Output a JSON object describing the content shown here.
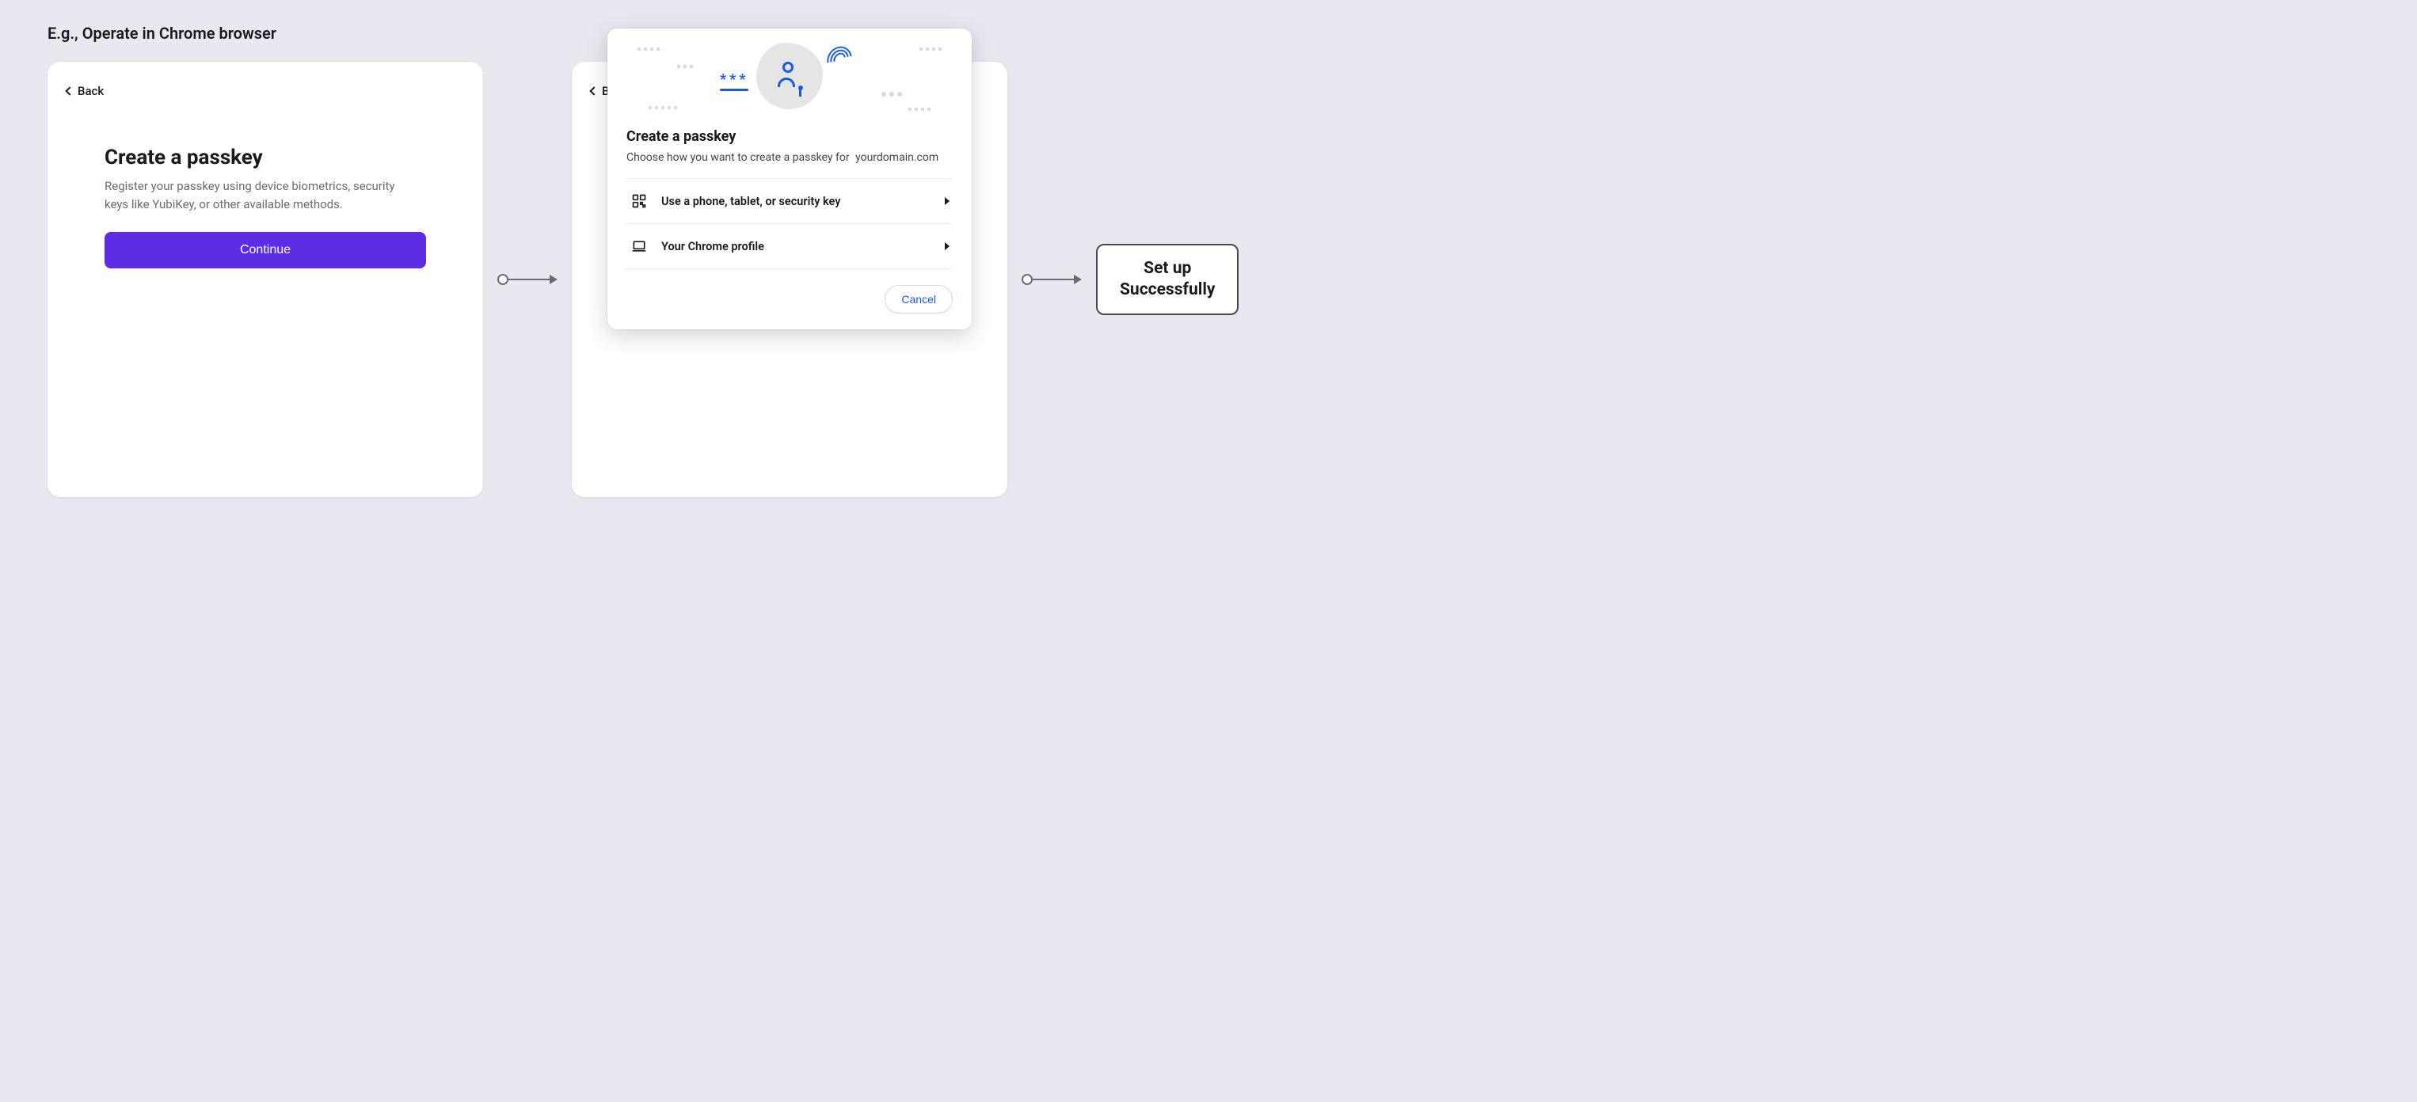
{
  "caption": "E.g., Operate in Chrome browser",
  "step1": {
    "back_label": "Back",
    "title": "Create a passkey",
    "description": "Register your passkey using device biometrics, security keys like YubiKey, or other available methods.",
    "continue_label": "Continue"
  },
  "step2": {
    "back_label_partial": "B",
    "dialog": {
      "title": "Create a passkey",
      "subtitle_prefix": "Choose how you want to create a passkey for",
      "domain": "yourdomain.com",
      "options": [
        {
          "icon": "qr-device-icon",
          "label": "Use a phone, tablet, or security key"
        },
        {
          "icon": "laptop-icon",
          "label": "Your Chrome profile"
        }
      ],
      "cancel_label": "Cancel"
    }
  },
  "result": {
    "line1": "Set up",
    "line2": "Successfully"
  }
}
